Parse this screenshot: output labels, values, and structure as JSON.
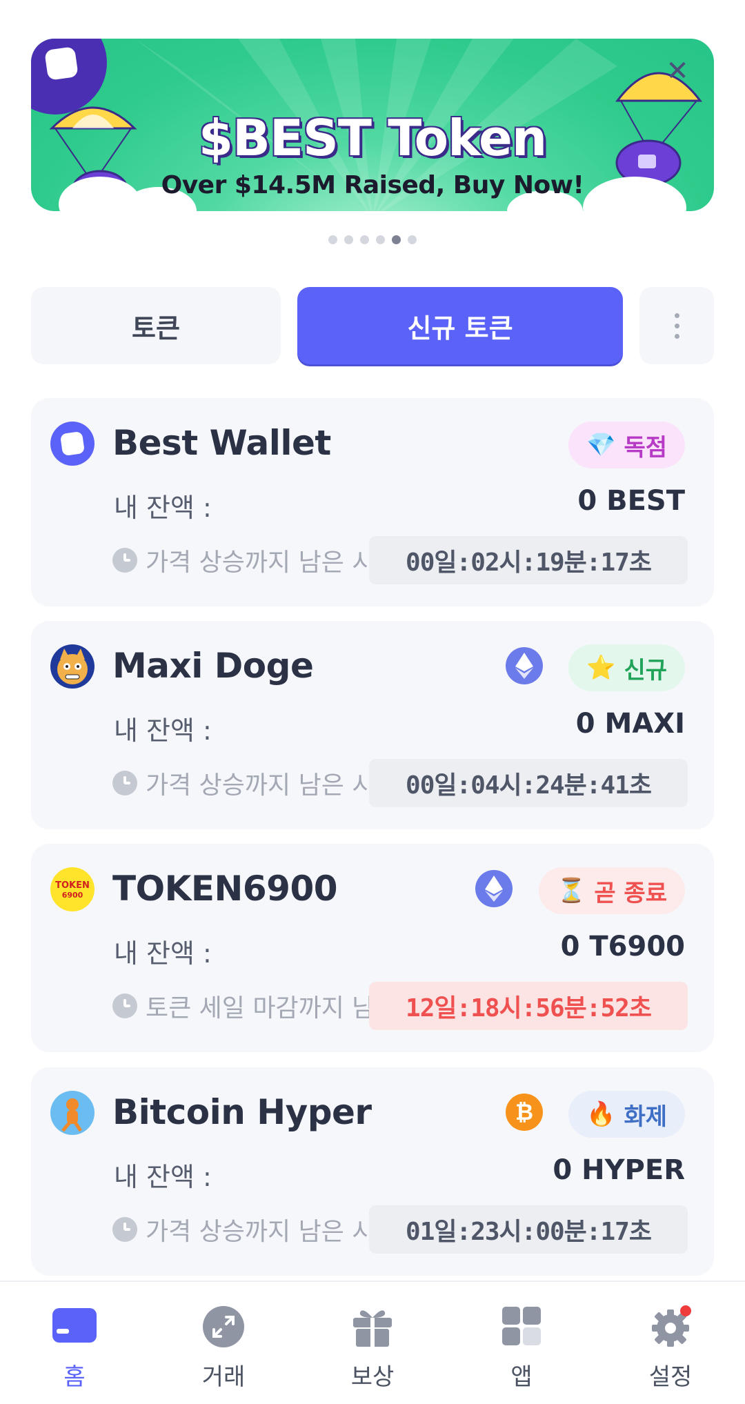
{
  "banner": {
    "title": "$BEST Token",
    "subtitle": "Over $14.5M Raised, Buy Now!",
    "close_label": "✕",
    "dot_count": 6,
    "active_dot": 4
  },
  "tabs": {
    "tokens_label": "토큰",
    "new_tokens_label": "신규 토큰",
    "more_label": "more"
  },
  "cards": [
    {
      "name": "Best Wallet",
      "badge_icon": "💎",
      "badge_text": "독점",
      "balance_label": "내 잔액 :",
      "balance_value": "0 BEST",
      "timer_label": "가격 상승까지 남은 시간",
      "timer_value": "00일:02시:19분:17초"
    },
    {
      "name": "Maxi Doge",
      "badge_icon": "⭐",
      "badge_text": "신규",
      "balance_label": "내 잔액 :",
      "balance_value": "0 MAXI",
      "timer_label": "가격 상승까지 남은 시간",
      "timer_value": "00일:04시:24분:41초"
    },
    {
      "name": "TOKEN6900",
      "badge_icon": "⏳",
      "badge_text": "곧 종료",
      "balance_label": "내 잔액 :",
      "balance_value": "0 T6900",
      "timer_label": "토큰 세일 마감까지 남은 시간",
      "timer_value": "12일:18시:56분:52초"
    },
    {
      "name": "Bitcoin Hyper",
      "badge_icon": "🔥",
      "badge_text": "화제",
      "balance_label": "내 잔액 :",
      "balance_value": "0 HYPER",
      "timer_label": "가격 상승까지 남은 시간",
      "timer_value": "01일:23시:00분:17초"
    }
  ],
  "nav": {
    "home": "홈",
    "trade": "거래",
    "rewards": "보상",
    "apps": "앱",
    "settings": "설정"
  },
  "colors": {
    "accent": "#5b62f7",
    "banner_green": "#2fcb8c",
    "urgent_red": "#ef5151",
    "eth_blue": "#6b7bea",
    "btc_orange": "#f7931a"
  }
}
